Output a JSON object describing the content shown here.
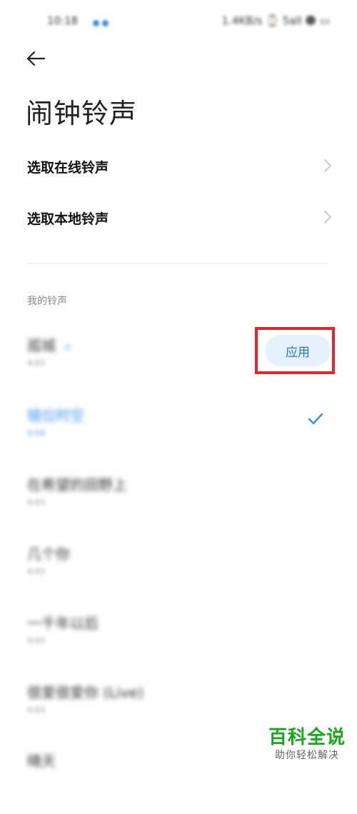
{
  "status_bar": {
    "time": "10:18",
    "right_text": "1.4KB/s ⌚ 5all ☻ ▭"
  },
  "header": {
    "title": "闹钟铃声"
  },
  "menu": {
    "online": "选取在线铃声",
    "local": "选取本地铃声"
  },
  "my_ringtones": {
    "section_title": "我的铃声",
    "apply_label": "应用",
    "items": [
      {
        "name": "孤城",
        "sub": "4:03"
      },
      {
        "name": "错位时空",
        "sub": "4:54"
      },
      {
        "name": "在希望的田野上",
        "sub": "4:03"
      },
      {
        "name": "几个你",
        "sub": "4:03"
      },
      {
        "name": "一千年以后",
        "sub": "4:03"
      },
      {
        "name": "很爱很爱你 (Live)",
        "sub": "4:03"
      },
      {
        "name": "晴天",
        "sub": "4:03"
      }
    ]
  },
  "colors": {
    "accent": "#3b8fe6",
    "highlight_border": "#e8242a",
    "watermark_green": "#1aa61a"
  },
  "watermark": {
    "title": "百科全说",
    "subtitle": "助你轻松解决"
  }
}
